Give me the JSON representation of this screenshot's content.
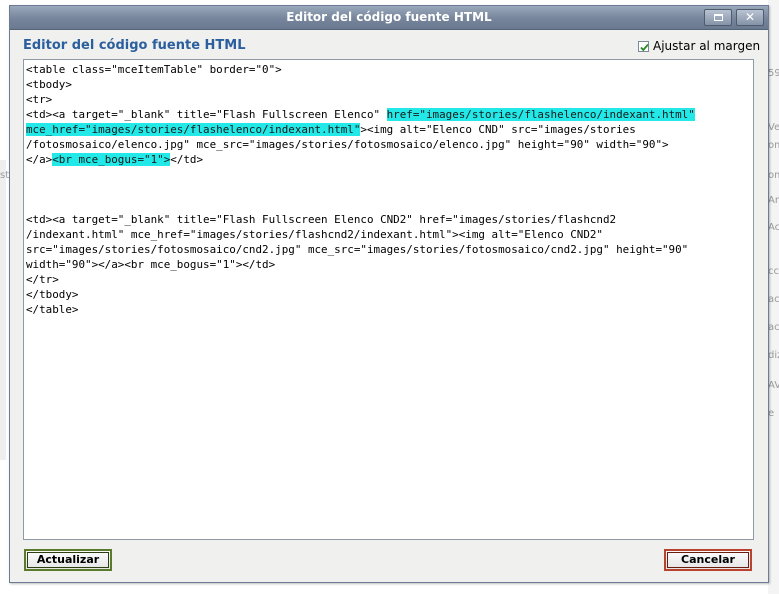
{
  "dialog": {
    "title": "Editor del código fuente HTML",
    "heading": "Editor del código fuente HTML",
    "wrap_label": "Ajustar al margen",
    "wrap_checked": true
  },
  "editor": {
    "lines": [
      {
        "parts": [
          {
            "t": "<table class=\"mceItemTable\" border=\"0\">"
          }
        ]
      },
      {
        "parts": [
          {
            "t": "<tbody>"
          }
        ]
      },
      {
        "parts": [
          {
            "t": "<tr>"
          }
        ]
      },
      {
        "parts": [
          {
            "t": "<td><a target=\"_blank\" title=\"Flash Fullscreen Elenco\" "
          },
          {
            "t": "href=\"images/stories/flashelenco/indexant.html\"",
            "hl": true
          }
        ]
      },
      {
        "parts": [
          {
            "t": "mce_href=\"images/stories/flashelenco/indexant.html\"",
            "hl": true
          },
          {
            "t": "><img alt=\"Elenco CND\" src=\"images/stories"
          }
        ]
      },
      {
        "parts": [
          {
            "t": "/fotosmosaico/elenco.jpg\" mce_src=\"images/stories/fotosmosaico/elenco.jpg\" height=\"90\" width=\"90\">"
          }
        ]
      },
      {
        "parts": [
          {
            "t": "</a>"
          },
          {
            "t": "<br mce_bogus=\"1\">",
            "hl": true
          },
          {
            "t": "</td>"
          }
        ]
      },
      {
        "parts": [
          {
            "t": ""
          }
        ]
      },
      {
        "parts": [
          {
            "t": ""
          }
        ]
      },
      {
        "parts": [
          {
            "t": ""
          }
        ]
      },
      {
        "parts": [
          {
            "t": "<td><a target=\"_blank\" title=\"Flash Fullscreen Elenco CND2\" href=\"images/stories/flashcnd2"
          }
        ]
      },
      {
        "parts": [
          {
            "t": "/indexant.html\" mce_href=\"images/stories/flashcnd2/indexant.html\"><img alt=\"Elenco CND2\""
          }
        ]
      },
      {
        "parts": [
          {
            "t": "src=\"images/stories/fotosmosaico/cnd2.jpg\" mce_src=\"images/stories/fotosmosaico/cnd2.jpg\" height=\"90\""
          }
        ]
      },
      {
        "parts": [
          {
            "t": "width=\"90\"></a><br mce_bogus=\"1\"></td>"
          }
        ]
      },
      {
        "parts": [
          {
            "t": "</tr>"
          }
        ]
      },
      {
        "parts": [
          {
            "t": "</tbody>"
          }
        ]
      },
      {
        "parts": [
          {
            "t": "</table>"
          }
        ]
      }
    ]
  },
  "buttons": {
    "update": "Actualizar",
    "cancel": "Cancelar"
  },
  "background_fragments": [
    "59",
    "Ve",
    "om",
    "om",
    "Ar",
    "Ac",
    "cc",
    "ac",
    "ac",
    "diz",
    "AV",
    "e",
    "sti"
  ],
  "colors": {
    "highlight": "#22e8e8",
    "heading": "#2b5f9e",
    "update_border": "#5c7a2c",
    "cancel_border": "#b8432e"
  }
}
